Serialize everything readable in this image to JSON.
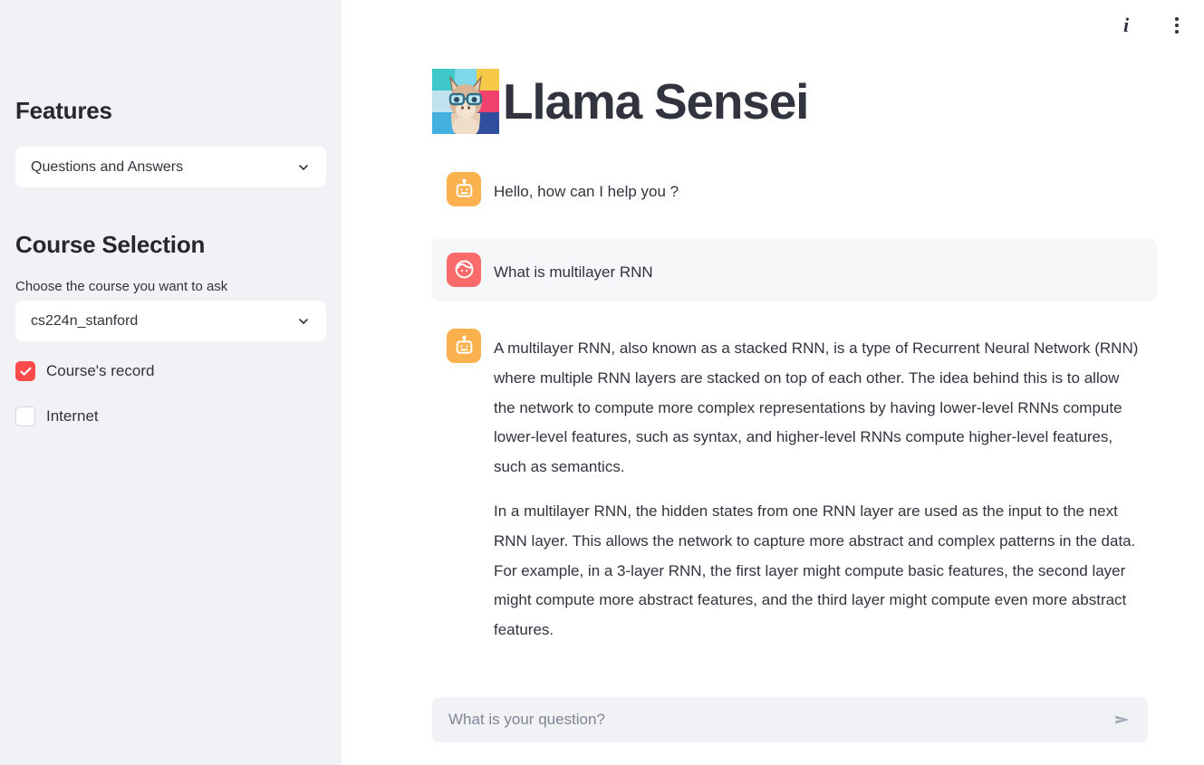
{
  "sidebar": {
    "features_heading": "Features",
    "feature_select": {
      "name": "feature-select",
      "value": "Questions and Answers",
      "options": [
        "Questions and Answers"
      ]
    },
    "course_heading": "Course Selection",
    "course_label": "Choose the course you want to ask",
    "course_select": {
      "name": "course-select",
      "value": "cs224n_stanford",
      "options": [
        "cs224n_stanford"
      ]
    },
    "checkboxes": [
      {
        "label": "Course's record",
        "checked": true
      },
      {
        "label": "Internet",
        "checked": false
      }
    ]
  },
  "topbar": {
    "info_glyph": "i",
    "info_name": "info-icon",
    "menu_name": "more-options-icon"
  },
  "header": {
    "title": "Llama Sensei",
    "logo_alt": "llama-with-glasses-logo",
    "logo_colors": [
      "#3ec8c8",
      "#7fd8e8",
      "#f7c948",
      "#bfe3ef",
      "#e8628c",
      "#f0426d",
      "#43b0e0",
      "#2d4a8a",
      "#2f4f9e"
    ]
  },
  "chat": {
    "messages": [
      {
        "role": "assistant",
        "avatar": "robot-icon",
        "avatar_color": "#fbb24e",
        "paragraphs": [
          "Hello, how can I help you ?"
        ]
      },
      {
        "role": "user",
        "avatar": "user-face-icon",
        "avatar_color": "#f96b6b",
        "paragraphs": [
          "What is multilayer RNN"
        ]
      },
      {
        "role": "assistant",
        "avatar": "robot-icon",
        "avatar_color": "#fbb24e",
        "paragraphs": [
          "A multilayer RNN, also known as a stacked RNN, is a type of Recurrent Neural Network (RNN) where multiple RNN layers are stacked on top of each other. The idea behind this is to allow the network to compute more complex representations by having lower-level RNNs compute lower-level features, such as syntax, and higher-level RNNs compute higher-level features, such as semantics.",
          "In a multilayer RNN, the hidden states from one RNN layer are used as the input to the next RNN layer. This allows the network to capture more abstract and complex patterns in the data. For example, in a 3-layer RNN, the first layer might compute basic features, the second layer might compute more abstract features, and the third layer might compute even more abstract features."
        ]
      }
    ]
  },
  "composer": {
    "placeholder": "What is your question?",
    "value": "",
    "send_label": "send-icon"
  },
  "colors": {
    "sidebar_bg": "#f0f2f6",
    "accent_red": "#ff4b4b",
    "assistant_orange": "#fbb24e",
    "user_salmon": "#f96b6b",
    "text": "#31333f",
    "user_bubble_bg": "#f5f7f9"
  }
}
